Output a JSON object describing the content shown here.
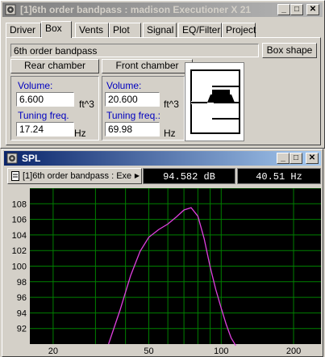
{
  "box_window": {
    "title": "[1]6th order bandpass : madison Executioner X 21",
    "controls": {
      "minimize": "_",
      "maximize": "□",
      "close": "✕"
    },
    "tabs": [
      {
        "label": "Driver"
      },
      {
        "label": "Box",
        "selected": true
      },
      {
        "label": "Vents"
      },
      {
        "label": "Plot"
      },
      {
        "label": "Signal"
      },
      {
        "label": "EQ/Filter"
      },
      {
        "label": "Project"
      }
    ],
    "box_name": "6th order bandpass",
    "box_shape_button": "Box shape",
    "rear": {
      "button": "Rear chamber",
      "volume_label": "Volume:",
      "volume_value": "6.600",
      "volume_unit": "ft^3",
      "tuning_label": "Tuning freq.",
      "tuning_value": "17.24",
      "tuning_unit": "Hz"
    },
    "front": {
      "button": "Front chamber",
      "volume_label": "Volume:",
      "volume_value": "20.600",
      "volume_unit": "ft^3",
      "tuning_label": "Tuning freq.:",
      "tuning_value": "69.98",
      "tuning_unit": "Hz"
    }
  },
  "spl_window": {
    "title": "SPL",
    "controls": {
      "minimize": "_",
      "maximize": "□",
      "close": "✕"
    },
    "trace_selector": "[1]6th order bandpass : Exe",
    "readout_db": "94.582 dB",
    "readout_hz": "40.51 Hz"
  },
  "colors": {
    "curve": "#e040e0",
    "grid": "#008000",
    "title_active": "#0a246a",
    "label_blue": "#0000c0"
  },
  "chart_data": {
    "type": "line",
    "title": "",
    "xlabel": "",
    "ylabel": "",
    "x_scale": "log",
    "xlim": [
      16,
      260
    ],
    "ylim": [
      90,
      110
    ],
    "x_ticks": [
      20,
      50,
      100,
      200
    ],
    "x_tick_labels": [
      "20",
      "50",
      "100",
      "200"
    ],
    "y_ticks": [
      92,
      94,
      96,
      98,
      100,
      102,
      104,
      106,
      108
    ],
    "y_tick_labels": [
      "92",
      "94",
      "96",
      "98",
      "100",
      "102",
      "104",
      "106",
      "108"
    ],
    "grid": true,
    "series": [
      {
        "color": "#e040e0",
        "x": [
          34,
          38,
          42,
          46,
          50,
          55,
          60,
          65,
          70,
          75,
          80,
          85,
          90,
          95,
          100,
          105,
          110,
          115
        ],
        "y": [
          90,
          94.4,
          98.8,
          101.9,
          103.7,
          104.7,
          105.4,
          106.3,
          107.2,
          107.5,
          106.4,
          103.5,
          99.9,
          97.0,
          94.6,
          92.5,
          90.8,
          89.8
        ]
      }
    ]
  }
}
